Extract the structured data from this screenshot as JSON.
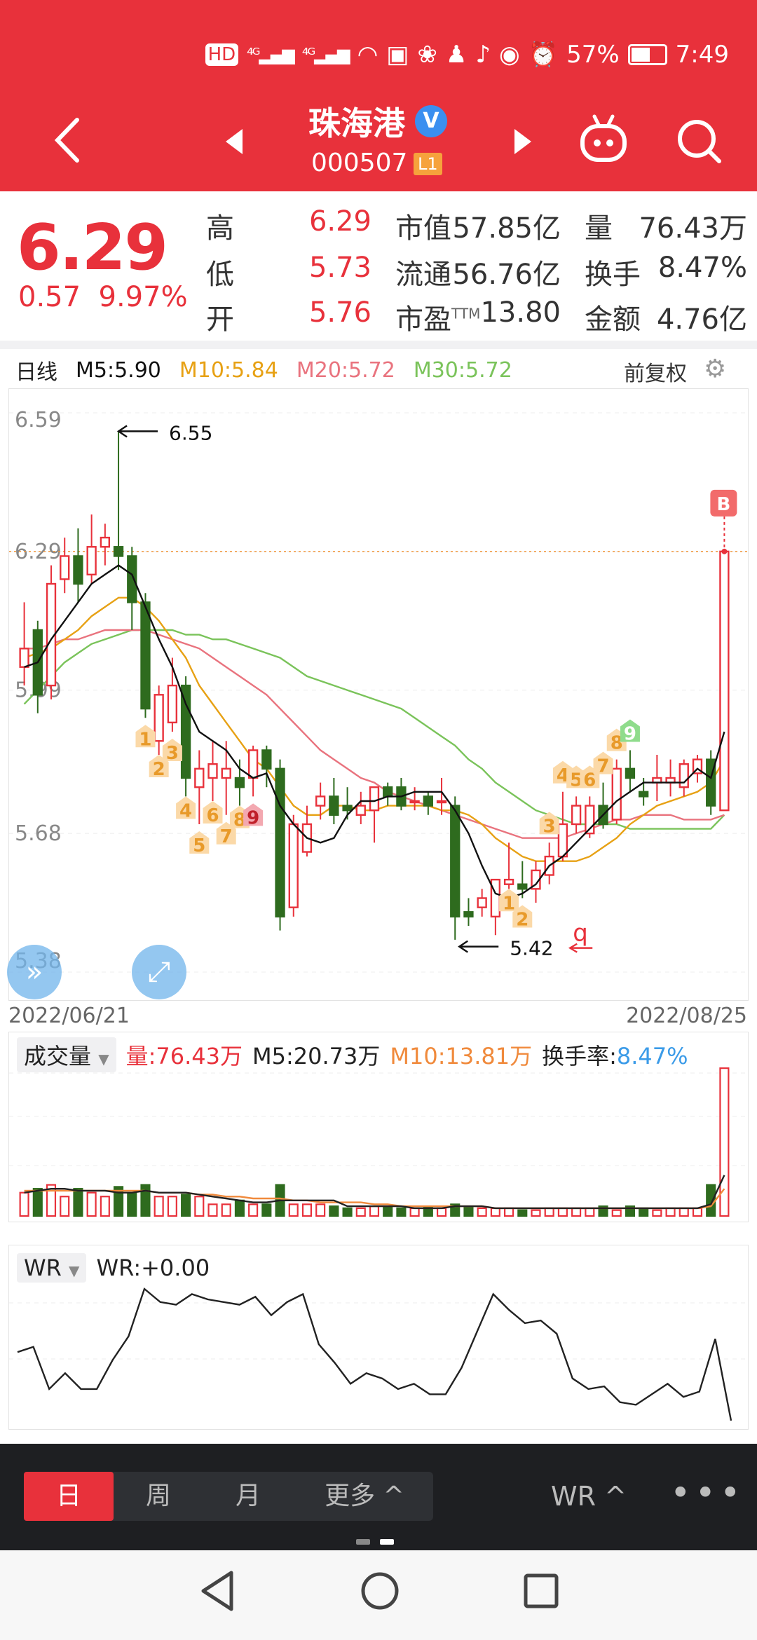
{
  "status_bar": {
    "icons": [
      "hd-icon",
      "signal-4g-icon",
      "signal-4g-icon",
      "wifi-icon",
      "app-icon",
      "app-icon",
      "qq-icon",
      "tiktok-icon",
      "eye-icon",
      "alarm-icon"
    ],
    "battery": "57%",
    "time": "7:49"
  },
  "header": {
    "name": "珠海港",
    "code": "000507",
    "level": "L1",
    "verified": "V"
  },
  "quote": {
    "price": "6.29",
    "change": "0.57",
    "change_pct": "9.97%",
    "high_label": "高",
    "high": "6.29",
    "low_label": "低",
    "low": "5.73",
    "open_label": "开",
    "open": "5.76",
    "mktcap_label": "市值",
    "mktcap": "57.85亿",
    "float_label": "流通",
    "float": "56.76亿",
    "pe_label": "市盈",
    "pe_sup": "TTM",
    "pe": "13.80",
    "vol_label": "量",
    "vol": "76.43万",
    "turn_label": "换手",
    "turn": "8.47%",
    "amt_label": "金额",
    "amt": "4.76亿"
  },
  "ma_legend": {
    "period": "日线",
    "m5": "M5:5.90",
    "m10": "M10:5.84",
    "m20": "M20:5.72",
    "m30": "M30:5.72",
    "adjust": "前复权"
  },
  "colors": {
    "up": "#e8313b",
    "down": "#2e6b1e",
    "m5": "#111111",
    "m10": "#e7a114",
    "m20": "#e9737e",
    "m30": "#7ac35a",
    "header": "#e8313b"
  },
  "chart_data": [
    {
      "type": "candlestick",
      "ylim": [
        5.38,
        6.59
      ],
      "y_ticks": [
        "6.59",
        "6.29",
        "5.99",
        "5.68",
        "5.38"
      ],
      "x_start_label": "2022/06/21",
      "x_end_label": "2022/08/25",
      "high_marker": "6.55",
      "low_marker": "5.42",
      "buy_tag": "B",
      "q_mark": "q",
      "candles": [
        {
          "o": 6.04,
          "c": 6.08,
          "h": 6.18,
          "l": 6.0
        },
        {
          "o": 6.12,
          "c": 5.98,
          "h": 6.14,
          "l": 5.94
        },
        {
          "o": 6.0,
          "c": 6.22,
          "h": 6.26,
          "l": 5.97
        },
        {
          "o": 6.23,
          "c": 6.28,
          "h": 6.32,
          "l": 6.2
        },
        {
          "o": 6.28,
          "c": 6.22,
          "h": 6.34,
          "l": 6.18
        },
        {
          "o": 6.24,
          "c": 6.3,
          "h": 6.37,
          "l": 6.22
        },
        {
          "o": 6.3,
          "c": 6.32,
          "h": 6.35,
          "l": 6.26
        },
        {
          "o": 6.3,
          "c": 6.28,
          "h": 6.55,
          "l": 6.25
        },
        {
          "o": 6.28,
          "c": 6.18,
          "h": 6.3,
          "l": 6.12
        },
        {
          "o": 6.18,
          "c": 5.95,
          "h": 6.2,
          "l": 5.93
        },
        {
          "o": 5.88,
          "c": 5.98,
          "h": 6.0,
          "l": 5.85
        },
        {
          "o": 5.92,
          "c": 6.0,
          "h": 6.06,
          "l": 5.9
        },
        {
          "o": 6.0,
          "c": 5.8,
          "h": 6.02,
          "l": 5.76
        },
        {
          "o": 5.78,
          "c": 5.82,
          "h": 5.86,
          "l": 5.7
        },
        {
          "o": 5.8,
          "c": 5.83,
          "h": 5.88,
          "l": 5.75
        },
        {
          "o": 5.8,
          "c": 5.82,
          "h": 5.88,
          "l": 5.72
        },
        {
          "o": 5.8,
          "c": 5.78,
          "h": 5.84,
          "l": 5.74
        },
        {
          "o": 5.8,
          "c": 5.86,
          "h": 5.87,
          "l": 5.76
        },
        {
          "o": 5.86,
          "c": 5.82,
          "h": 5.87,
          "l": 5.78
        },
        {
          "o": 5.82,
          "c": 5.5,
          "h": 5.84,
          "l": 5.47
        },
        {
          "o": 5.52,
          "c": 5.7,
          "h": 5.72,
          "l": 5.5
        },
        {
          "o": 5.64,
          "c": 5.7,
          "h": 5.74,
          "l": 5.63
        },
        {
          "o": 5.74,
          "c": 5.76,
          "h": 5.79,
          "l": 5.71
        },
        {
          "o": 5.76,
          "c": 5.72,
          "h": 5.8,
          "l": 5.7
        },
        {
          "o": 5.74,
          "c": 5.73,
          "h": 5.78,
          "l": 5.71
        },
        {
          "o": 5.72,
          "c": 5.74,
          "h": 5.77,
          "l": 5.7
        },
        {
          "o": 5.73,
          "c": 5.78,
          "h": 5.78,
          "l": 5.66
        },
        {
          "o": 5.78,
          "c": 5.76,
          "h": 5.79,
          "l": 5.74
        },
        {
          "o": 5.78,
          "c": 5.74,
          "h": 5.8,
          "l": 5.73
        },
        {
          "o": 5.75,
          "c": 5.75,
          "h": 5.78,
          "l": 5.73
        },
        {
          "o": 5.76,
          "c": 5.74,
          "h": 5.77,
          "l": 5.72
        },
        {
          "o": 5.75,
          "c": 5.75,
          "h": 5.8,
          "l": 5.72
        },
        {
          "o": 5.74,
          "c": 5.5,
          "h": 5.76,
          "l": 5.45
        },
        {
          "o": 5.51,
          "c": 5.5,
          "h": 5.54,
          "l": 5.48
        },
        {
          "o": 5.52,
          "c": 5.54,
          "h": 5.56,
          "l": 5.5
        },
        {
          "o": 5.5,
          "c": 5.58,
          "h": 5.58,
          "l": 5.46
        },
        {
          "o": 5.57,
          "c": 5.58,
          "h": 5.66,
          "l": 5.56
        },
        {
          "o": 5.57,
          "c": 5.56,
          "h": 5.62,
          "l": 5.54
        },
        {
          "o": 5.56,
          "c": 5.6,
          "h": 5.62,
          "l": 5.53
        },
        {
          "o": 5.59,
          "c": 5.63,
          "h": 5.66,
          "l": 5.57
        },
        {
          "o": 5.63,
          "c": 5.7,
          "h": 5.77,
          "l": 5.62
        },
        {
          "o": 5.7,
          "c": 5.74,
          "h": 5.76,
          "l": 5.68
        },
        {
          "o": 5.68,
          "c": 5.74,
          "h": 5.76,
          "l": 5.67
        },
        {
          "o": 5.74,
          "c": 5.7,
          "h": 5.79,
          "l": 5.69
        },
        {
          "o": 5.71,
          "c": 5.82,
          "h": 5.84,
          "l": 5.7
        },
        {
          "o": 5.82,
          "c": 5.8,
          "h": 5.86,
          "l": 5.77
        },
        {
          "o": 5.77,
          "c": 5.76,
          "h": 5.8,
          "l": 5.74
        },
        {
          "o": 5.79,
          "c": 5.8,
          "h": 5.85,
          "l": 5.75
        },
        {
          "o": 5.79,
          "c": 5.8,
          "h": 5.84,
          "l": 5.76
        },
        {
          "o": 5.78,
          "c": 5.83,
          "h": 5.84,
          "l": 5.76
        },
        {
          "o": 5.81,
          "c": 5.84,
          "h": 5.85,
          "l": 5.79
        },
        {
          "o": 5.84,
          "c": 5.74,
          "h": 5.86,
          "l": 5.72
        },
        {
          "o": 5.73,
          "c": 6.29,
          "h": 6.29,
          "l": 5.73
        }
      ],
      "td_marks": [
        {
          "i": 9,
          "t": "1",
          "below": true
        },
        {
          "i": 10,
          "t": "2",
          "below": true
        },
        {
          "i": 11,
          "t": "3",
          "below": true
        },
        {
          "i": 12,
          "t": "4",
          "below": true
        },
        {
          "i": 13,
          "t": "5",
          "below": true
        },
        {
          "i": 14,
          "t": "6",
          "below": true
        },
        {
          "i": 15,
          "t": "7",
          "below": true
        },
        {
          "i": 16,
          "t": "8",
          "below": true
        },
        {
          "i": 17,
          "t": "9",
          "below": true,
          "final": true
        },
        {
          "i": 36,
          "t": "1",
          "below": true
        },
        {
          "i": 37,
          "t": "2",
          "below": true
        },
        {
          "i": 39,
          "t": "3",
          "below": false
        },
        {
          "i": 40,
          "t": "4",
          "below": false
        },
        {
          "i": 41,
          "t": "5",
          "below": false
        },
        {
          "i": 42,
          "t": "6",
          "below": false
        },
        {
          "i": 43,
          "t": "7",
          "below": false
        },
        {
          "i": 44,
          "t": "8",
          "below": false
        },
        {
          "i": 45,
          "t": "9",
          "below": false,
          "final": true
        }
      ],
      "ma5": [
        6.04,
        6.05,
        6.1,
        6.14,
        6.18,
        6.22,
        6.24,
        6.26,
        6.24,
        6.17,
        6.1,
        6.04,
        5.96,
        5.9,
        5.88,
        5.86,
        5.82,
        5.8,
        5.81,
        5.74,
        5.7,
        5.67,
        5.66,
        5.67,
        5.72,
        5.75,
        5.75,
        5.76,
        5.76,
        5.77,
        5.77,
        5.77,
        5.73,
        5.68,
        5.61,
        5.55,
        5.54,
        5.55,
        5.57,
        5.61,
        5.63,
        5.66,
        5.69,
        5.72,
        5.75,
        5.77,
        5.79,
        5.79,
        5.79,
        5.79,
        5.82,
        5.8,
        5.9
      ],
      "ma10": [
        6.06,
        6.07,
        6.08,
        6.1,
        6.12,
        6.15,
        6.17,
        6.19,
        6.19,
        6.17,
        6.14,
        6.1,
        6.06,
        6.0,
        5.96,
        5.92,
        5.88,
        5.84,
        5.82,
        5.78,
        5.74,
        5.72,
        5.72,
        5.74,
        5.74,
        5.73,
        5.73,
        5.74,
        5.74,
        5.74,
        5.74,
        5.73,
        5.73,
        5.72,
        5.7,
        5.67,
        5.65,
        5.63,
        5.62,
        5.62,
        5.62,
        5.62,
        5.63,
        5.65,
        5.67,
        5.7,
        5.72,
        5.74,
        5.75,
        5.76,
        5.77,
        5.79,
        5.84
      ],
      "ma20": [
        6.08,
        6.08,
        6.09,
        6.1,
        6.1,
        6.11,
        6.12,
        6.12,
        6.12,
        6.12,
        6.11,
        6.1,
        6.09,
        6.08,
        6.06,
        6.04,
        6.02,
        6.0,
        5.98,
        5.95,
        5.92,
        5.89,
        5.86,
        5.84,
        5.82,
        5.8,
        5.79,
        5.77,
        5.76,
        5.75,
        5.74,
        5.73,
        5.72,
        5.71,
        5.7,
        5.69,
        5.68,
        5.67,
        5.67,
        5.67,
        5.67,
        5.68,
        5.69,
        5.7,
        5.71,
        5.71,
        5.72,
        5.72,
        5.72,
        5.71,
        5.71,
        5.71,
        5.72
      ],
      "ma30": [
        5.96,
        5.99,
        6.02,
        6.05,
        6.07,
        6.09,
        6.1,
        6.11,
        6.12,
        6.12,
        6.12,
        6.12,
        6.11,
        6.11,
        6.1,
        6.1,
        6.09,
        6.08,
        6.07,
        6.06,
        6.04,
        6.02,
        6.01,
        6.0,
        5.99,
        5.98,
        5.97,
        5.96,
        5.95,
        5.93,
        5.91,
        5.89,
        5.87,
        5.84,
        5.82,
        5.79,
        5.77,
        5.75,
        5.73,
        5.72,
        5.71,
        5.7,
        5.7,
        5.7,
        5.7,
        5.69,
        5.69,
        5.69,
        5.69,
        5.69,
        5.69,
        5.69,
        5.72
      ]
    },
    {
      "type": "bar",
      "title": "成交量",
      "vol_label": "量:76.43万",
      "m5_label": "M5:20.73万",
      "m10_label": "M10:13.81万",
      "turnover_label": "换手率:",
      "turnover_value": "8.47%",
      "ylim": [
        0,
        80
      ],
      "values": [
        12,
        14,
        16,
        10,
        14,
        12,
        10,
        15,
        12,
        16,
        10,
        10,
        11,
        10,
        6,
        6,
        8,
        6,
        6,
        16,
        6,
        6,
        6,
        5,
        4,
        4,
        5,
        5,
        4,
        4,
        5,
        4,
        6,
        5,
        4,
        4,
        4,
        3,
        3,
        4,
        4,
        4,
        4,
        5,
        3,
        5,
        4,
        3,
        4,
        4,
        4,
        16,
        76
      ],
      "ma5": [
        12,
        13,
        14,
        14,
        13,
        13,
        13,
        12,
        12,
        13,
        12,
        12,
        12,
        11,
        10,
        9,
        8,
        7,
        7,
        8,
        8,
        8,
        8,
        8,
        5,
        5,
        5,
        5,
        5,
        4,
        4,
        4,
        5,
        5,
        5,
        4,
        4,
        4,
        4,
        4,
        4,
        4,
        4,
        4,
        4,
        4,
        4,
        4,
        4,
        4,
        4,
        6,
        21
      ],
      "ma10": [
        13,
        13,
        13,
        13,
        13,
        13,
        13,
        13,
        13,
        13,
        12,
        12,
        12,
        11,
        11,
        10,
        10,
        9,
        9,
        9,
        8,
        8,
        7,
        7,
        7,
        7,
        6,
        6,
        5,
        5,
        5,
        5,
        5,
        5,
        5,
        4,
        4,
        4,
        4,
        4,
        4,
        4,
        4,
        4,
        4,
        4,
        4,
        4,
        4,
        4,
        4,
        5,
        14
      ]
    },
    {
      "type": "line",
      "title": "WR",
      "label": "WR:+0.00",
      "ylim": [
        0,
        100
      ],
      "values": [
        52,
        56,
        24,
        36,
        24,
        24,
        46,
        64,
        100,
        90,
        88,
        96,
        92,
        90,
        88,
        94,
        80,
        90,
        96,
        58,
        44,
        28,
        36,
        32,
        24,
        28,
        20,
        20,
        40,
        68,
        96,
        84,
        74,
        76,
        66,
        32,
        24,
        26,
        14,
        12,
        20,
        28,
        18,
        22,
        62,
        0
      ]
    }
  ],
  "tabs": {
    "day": "日",
    "week": "周",
    "month": "月",
    "more": "更多",
    "more_caret": "^",
    "indicator": "WR",
    "indicator_caret": "^",
    "dots": "•••"
  }
}
